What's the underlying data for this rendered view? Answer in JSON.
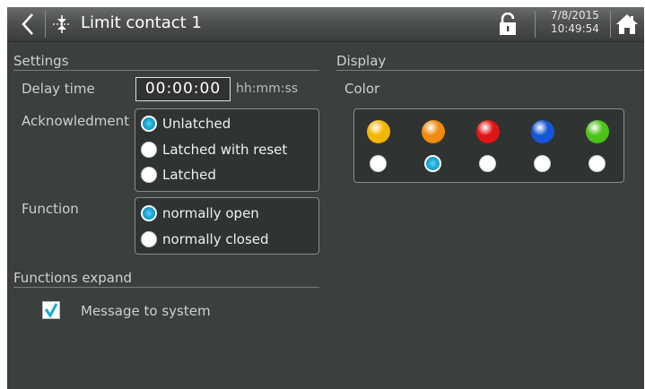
{
  "header": {
    "title": "Limit contact 1",
    "date": "7/8/2015",
    "time": "10:49:54",
    "icons": {
      "back": "back-arrow-icon",
      "title": "limit-contact-icon",
      "lock": "unlocked-padlock-icon",
      "home": "home-icon"
    }
  },
  "settings": {
    "heading": "Settings",
    "delay_label": "Delay time",
    "delay_value": "00:00:00",
    "delay_unit": "hh:mm:ss",
    "ack_label": "Acknowledment",
    "ack_options": [
      "Unlatched",
      "Latched with reset",
      "Latched"
    ],
    "ack_selected": "Unlatched",
    "function_label": "Function",
    "function_options": [
      "normally open",
      "normally closed"
    ],
    "function_selected": "normally open"
  },
  "display": {
    "heading": "Display",
    "color_label": "Color",
    "colors": [
      "#f2b800",
      "#f08a10",
      "#e01414",
      "#1456d6",
      "#4fc21a"
    ],
    "selected_index": 1
  },
  "functions_expand": {
    "heading": "Functions expand",
    "message_label": "Message to system",
    "message_checked": true
  },
  "theme": {
    "background": "#3b3f3e",
    "accent": "#1aa9d6"
  }
}
